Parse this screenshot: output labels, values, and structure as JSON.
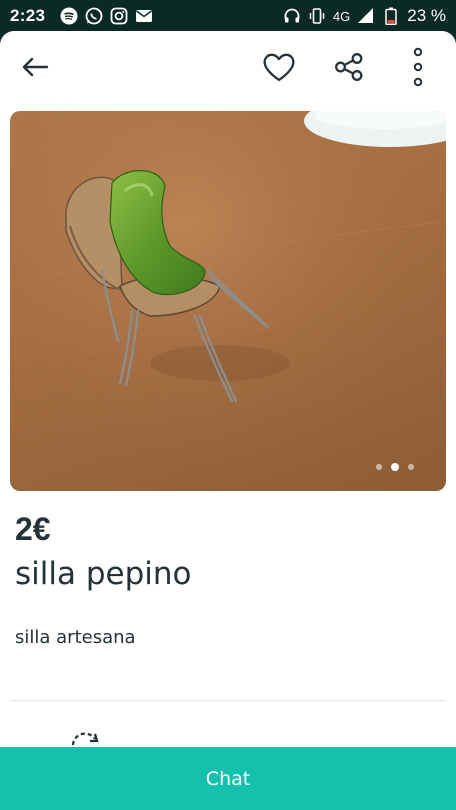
{
  "status_bar": {
    "time": "2:23",
    "network": "4G",
    "battery": "23 %"
  },
  "icons": {
    "back": "arrow-left-icon",
    "favorite": "heart-icon",
    "share": "share-icon",
    "more": "more-vertical-icon"
  },
  "gallery": {
    "image_description_icon": "product-photo",
    "dots": 3,
    "active_dot": 2
  },
  "product": {
    "price": "2€",
    "title": "silla pepino",
    "description": "silla artesana"
  },
  "chat_button": {
    "label": "Chat"
  },
  "colors": {
    "accent": "#13c1ac",
    "text": "#253238",
    "status_bar": "#0b2a26"
  }
}
